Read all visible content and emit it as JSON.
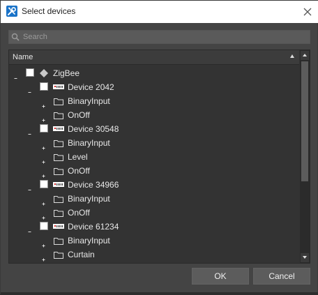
{
  "window": {
    "title": "Select devices",
    "title_icon": "wrench-screwdriver-icon",
    "close_icon": "close-icon"
  },
  "search": {
    "placeholder": "Search",
    "value": ""
  },
  "tree": {
    "column_header": "Name",
    "sort": "ascending",
    "rows": [
      {
        "depth": 0,
        "expander": "minus",
        "icon": "diamond-icon",
        "label": "ZigBee",
        "checked": false
      },
      {
        "depth": 1,
        "expander": "minus",
        "icon": "device-icon",
        "label": "Device 2042",
        "checked": false
      },
      {
        "depth": 2,
        "expander": "plus",
        "icon": "folder-icon",
        "label": "BinaryInput"
      },
      {
        "depth": 2,
        "expander": "plus",
        "icon": "folder-icon",
        "label": "OnOff"
      },
      {
        "depth": 1,
        "expander": "minus",
        "icon": "device-icon",
        "label": "Device 30548",
        "checked": false
      },
      {
        "depth": 2,
        "expander": "plus",
        "icon": "folder-icon",
        "label": "BinaryInput"
      },
      {
        "depth": 2,
        "expander": "plus",
        "icon": "folder-icon",
        "label": "Level"
      },
      {
        "depth": 2,
        "expander": "plus",
        "icon": "folder-icon",
        "label": "OnOff"
      },
      {
        "depth": 1,
        "expander": "minus",
        "icon": "device-icon",
        "label": "Device 34966",
        "checked": false
      },
      {
        "depth": 2,
        "expander": "plus",
        "icon": "folder-icon",
        "label": "BinaryInput"
      },
      {
        "depth": 2,
        "expander": "plus",
        "icon": "folder-icon",
        "label": "OnOff"
      },
      {
        "depth": 1,
        "expander": "minus",
        "icon": "device-icon",
        "label": "Device 61234",
        "checked": false
      },
      {
        "depth": 2,
        "expander": "plus",
        "icon": "folder-icon",
        "label": "BinaryInput"
      },
      {
        "depth": 2,
        "expander": "plus",
        "icon": "folder-icon",
        "label": "Curtain"
      }
    ]
  },
  "buttons": {
    "ok": "OK",
    "cancel": "Cancel"
  },
  "colors": {
    "dialog_bg": "#444444",
    "tree_bg": "#333333",
    "title_icon_bg": "#1a73c8",
    "button_bg": "#5c5c5c"
  }
}
